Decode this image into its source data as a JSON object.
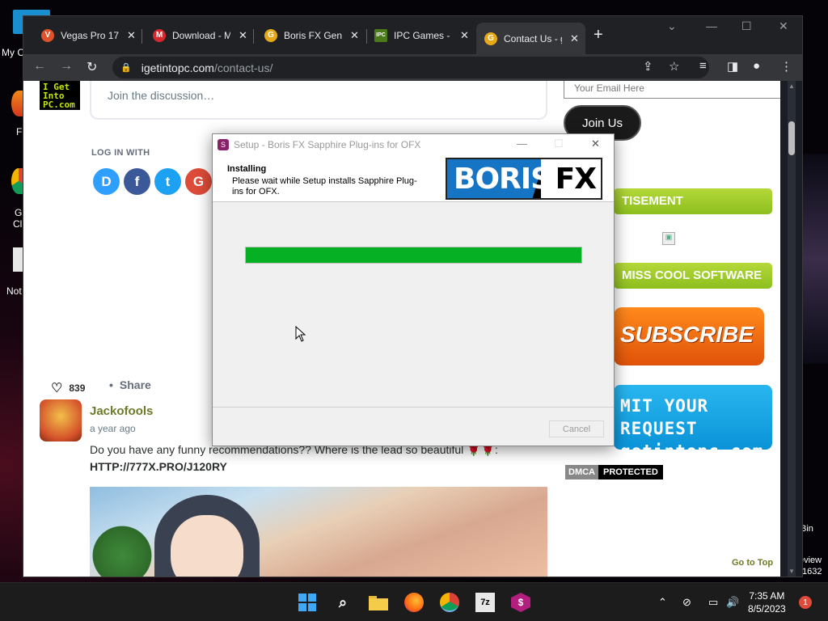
{
  "desktop": {
    "left_label_1": "My C",
    "left_label_2": "F",
    "left_label_3": "G",
    "left_label_4": "Cl",
    "left_label_5": "Not",
    "right_label_1": "Bin",
    "right_label_2": "eview",
    "right_label_3": "1632"
  },
  "browser": {
    "tabs": [
      {
        "label": "Vegas Pro 17",
        "favicon": "vegas-icon",
        "color": "#e0532a",
        "glyph": "V"
      },
      {
        "label": "Download - M",
        "favicon": "mega-icon",
        "color": "#d9272e",
        "glyph": "M"
      },
      {
        "label": "Boris FX Gene",
        "favicon": "g-icon",
        "color": "#e6a817",
        "glyph": "G"
      },
      {
        "label": "IPC Games - I",
        "favicon": "ipc-icon",
        "color": "#4a7a1a",
        "glyph": "IPC"
      },
      {
        "label": "Contact Us - g",
        "favicon": "g-icon",
        "color": "#e6a817",
        "glyph": "G"
      }
    ],
    "url_host": "igetintopc.com",
    "url_path": "/contact-us/"
  },
  "page": {
    "logo_text": "I GET INTO PC.COM",
    "logo_lines": [
      "I Get",
      "Into",
      "PC.com"
    ],
    "discussion_placeholder": "Join the discussion…",
    "login_with": "LOG IN WITH",
    "socials": [
      {
        "name": "disqus",
        "glyph": "D",
        "color": "#2e9fff"
      },
      {
        "name": "facebook",
        "glyph": "f",
        "color": "#3b5998"
      },
      {
        "name": "twitter",
        "glyph": "t",
        "color": "#1da1f2"
      },
      {
        "name": "google",
        "glyph": "G",
        "color": "#dd4b39"
      }
    ],
    "likes_count": "839",
    "share_label": "Share",
    "comment": {
      "author": "Jackofools",
      "time": "a year ago",
      "text": "Do you have any funny recommendations?? Where is the lead so beautiful 🌹🌹:",
      "url": "HTTP://777X.PRO/J120RY"
    },
    "email_placeholder": "Your Email Here",
    "join_button": "Join Us",
    "advert_banner": "TISEMENT",
    "miss_banner": "MISS COOL SOFTWARE",
    "subscribe_banner": "SUBSCRIBE",
    "request_line1": "MIT YOUR REQUEST",
    "request_line2": "getintopc.com",
    "dmca_label": "DMCA",
    "protected_label": "PROTECTED",
    "go_to_top": "Go to Top"
  },
  "dialog": {
    "title": "Setup - Boris FX Sapphire Plug-ins for OFX",
    "heading": "Installing",
    "subheading": "Please wait while Setup installs Sapphire Plug-ins for OFX.",
    "logo_word": "BORIS",
    "logo_fx": "FX",
    "progress_fraction": 1.0,
    "cancel_label": "Cancel"
  },
  "taskbar": {
    "time": "7:35 AM",
    "date": "8/5/2023",
    "notification_count": "1"
  }
}
